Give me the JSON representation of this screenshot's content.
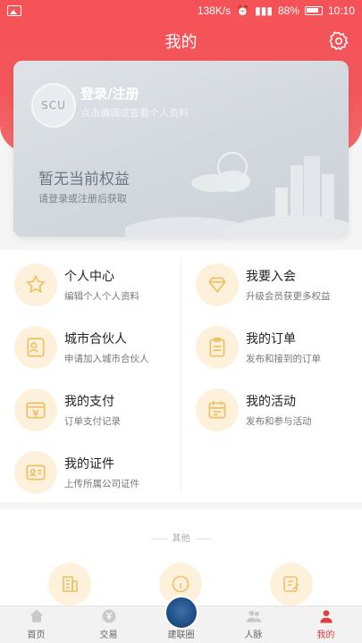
{
  "status": {
    "speed": "138K/s",
    "battery": "88%",
    "time": "10:10"
  },
  "header": {
    "title": "我的"
  },
  "card": {
    "avatar_text": "SCU",
    "login_title": "登录/注册",
    "login_subtitle": "点击编辑或查看个人资料",
    "benefit_title": "暂无当前权益",
    "benefit_subtitle": "请登录或注册后获取"
  },
  "menu": [
    {
      "title": "个人中心",
      "subtitle": "编辑个人个人资料",
      "icon": "star-badge-icon"
    },
    {
      "title": "我要入会",
      "subtitle": "升级会员获更多权益",
      "icon": "crown-gem-icon"
    },
    {
      "title": "城市合伙人",
      "subtitle": "申请加入城市合伙人",
      "icon": "partner-card-icon"
    },
    {
      "title": "我的订单",
      "subtitle": "发布和接到的订单",
      "icon": "clipboard-icon"
    },
    {
      "title": "我的支付",
      "subtitle": "订单支付记录",
      "icon": "yuan-wallet-icon"
    },
    {
      "title": "我的活动",
      "subtitle": "发布和参与活动",
      "icon": "calendar-icon"
    },
    {
      "title": "我的证件",
      "subtitle": "上传所属公司证件",
      "icon": "id-card-icon"
    }
  ],
  "others": {
    "label": "其他",
    "icons": [
      "building-icon",
      "info-icon",
      "edit-note-icon"
    ]
  },
  "tabs": [
    {
      "label": "首页",
      "icon": "home-icon"
    },
    {
      "label": "交易",
      "icon": "yuan-coin-icon"
    },
    {
      "label": "建联圈",
      "icon": "logo-emblem"
    },
    {
      "label": "人脉",
      "icon": "people-icon"
    },
    {
      "label": "我的",
      "icon": "person-icon",
      "active": true
    }
  ],
  "colors": {
    "brand_red": "#f45257",
    "icon_bg": "#fdf1dc",
    "icon_fg": "#f0c066",
    "active_tab": "#e23c41"
  }
}
